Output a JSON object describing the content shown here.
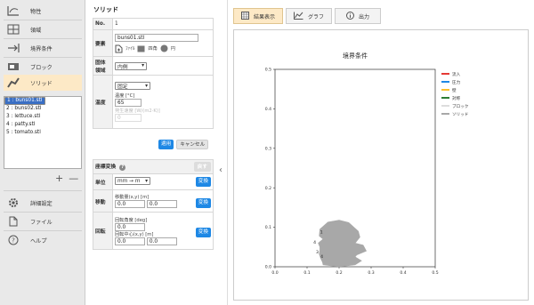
{
  "nav": {
    "items": [
      {
        "label": "物性",
        "icon": "material-icon"
      },
      {
        "label": "領域",
        "icon": "domain-grid-icon"
      },
      {
        "label": "境界条件",
        "icon": "boundary-arrow-icon"
      },
      {
        "label": "ブロック",
        "icon": "block-icon"
      },
      {
        "label": "ソリッド",
        "icon": "solid-icon",
        "active": true
      }
    ],
    "files": [
      "1 : buns01.stl",
      "2 : buns02.stl",
      "3 : lettuce.stl",
      "4 : patty.stl",
      "5 : tomato.stl"
    ],
    "add": "+",
    "remove": "—",
    "bottom": [
      {
        "label": "詳細設定",
        "icon": "gear-icon"
      },
      {
        "label": "ファイル",
        "icon": "file-icon"
      },
      {
        "label": "ヘルプ",
        "icon": "help-icon"
      }
    ]
  },
  "panel": {
    "title": "ソリッド",
    "no_label": "No.",
    "no_value": "1",
    "element_label": "要素",
    "element_value": "buns01.stl",
    "elem_file": "ﾌｧｲﾙ",
    "elem_rect": "四角",
    "elem_circle": "円",
    "region_label": "固体領域",
    "region_value": "内側",
    "fixed_value": "固定",
    "temp_label": "温度",
    "temp_sub": "温度 [°C]",
    "temp_value": "65",
    "heatgen_sub": "発生速度 [W/(m2·K)]",
    "heatgen_value": "0",
    "apply": "適用",
    "cancel": "キャンセル",
    "transform_title": "座標変換",
    "reset": "戻す",
    "unit_label": "単位",
    "unit_value": "mm → m",
    "convert": "変換",
    "move_label": "移動",
    "move_sub": "移動量(x,y) [m]",
    "move_x": "0.0",
    "move_y": "0.0",
    "rot_label": "回転",
    "rot_angle_sub": "回転角度 [deg]",
    "rot_angle": "0.0",
    "rot_center_sub": "回転中心(x,y) [m]",
    "rot_cx": "0.0",
    "rot_cy": "0.0"
  },
  "tabs": [
    {
      "label": "結果表示",
      "active": true
    },
    {
      "label": "グラフ"
    },
    {
      "label": "出力"
    }
  ],
  "chart_data": {
    "type": "area",
    "title": "境界条件",
    "xlim": [
      0.0,
      0.5
    ],
    "ylim": [
      0.0,
      0.5
    ],
    "xticks": [
      "0.0",
      "0.1",
      "0.2",
      "0.3",
      "0.4",
      "0.5"
    ],
    "yticks": [
      "0.0",
      "0.1",
      "0.2",
      "0.3",
      "0.4",
      "0.5"
    ],
    "legend_position": "top-right",
    "legend": [
      {
        "name": "流入",
        "color": "#e53935"
      },
      {
        "name": "圧力",
        "color": "#1e88e5"
      },
      {
        "name": "壁",
        "color": "#fbc02d"
      },
      {
        "name": "対称",
        "color": "#2e7d32"
      },
      {
        "name": "ブロック",
        "color": "#dddddd"
      },
      {
        "name": "ソリッド",
        "color": "#a8a8a8"
      }
    ],
    "solid_outline": [
      [
        0.15,
        0.005
      ],
      [
        0.2,
        0.0
      ],
      [
        0.25,
        0.005
      ],
      [
        0.27,
        0.015
      ],
      [
        0.25,
        0.025
      ],
      [
        0.255,
        0.03
      ],
      [
        0.285,
        0.04
      ],
      [
        0.275,
        0.055
      ],
      [
        0.25,
        0.06
      ],
      [
        0.265,
        0.075
      ],
      [
        0.26,
        0.09
      ],
      [
        0.23,
        0.112
      ],
      [
        0.2,
        0.118
      ],
      [
        0.165,
        0.113
      ],
      [
        0.14,
        0.095
      ],
      [
        0.138,
        0.078
      ],
      [
        0.15,
        0.07
      ],
      [
        0.135,
        0.06
      ],
      [
        0.14,
        0.05
      ],
      [
        0.14,
        0.042
      ],
      [
        0.138,
        0.032
      ],
      [
        0.143,
        0.02
      ],
      [
        0.148,
        0.012
      ]
    ],
    "labels": [
      {
        "text": "1",
        "x": 0.145,
        "y": 0.085
      },
      {
        "text": "4",
        "x": 0.124,
        "y": 0.058
      },
      {
        "text": "3",
        "x": 0.132,
        "y": 0.034
      },
      {
        "text": "4",
        "x": 0.146,
        "y": 0.022
      }
    ]
  }
}
